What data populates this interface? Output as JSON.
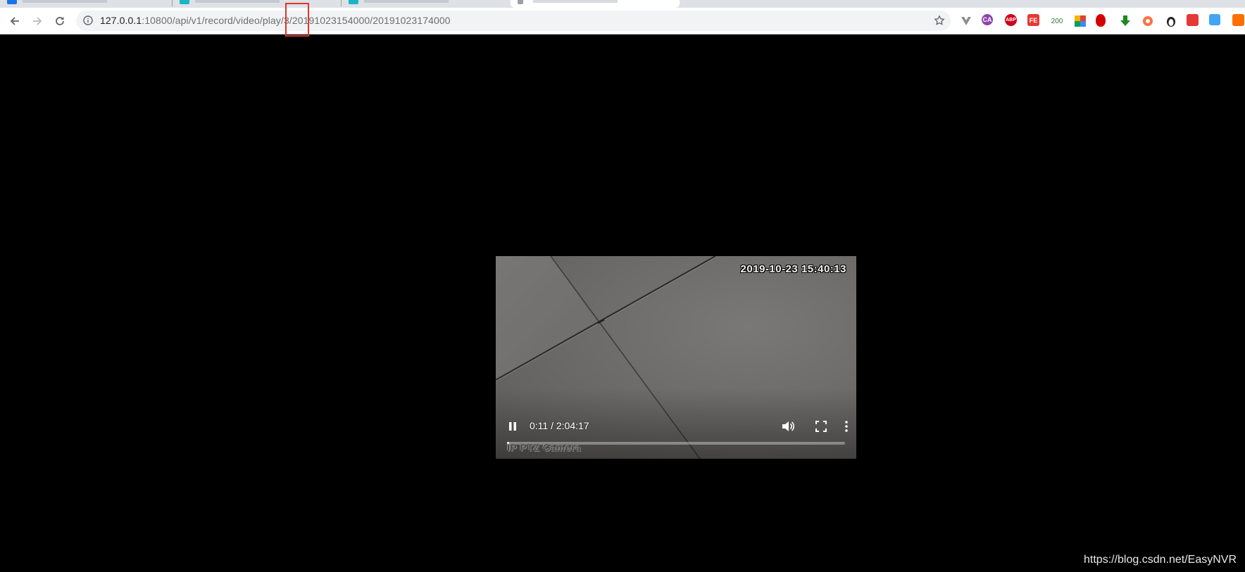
{
  "browser": {
    "tabs": [
      {
        "name": "tab-1",
        "favicon_color": "#1a73e8",
        "active": false
      },
      {
        "name": "tab-2",
        "favicon_color": "#19b5c8",
        "active": false
      },
      {
        "name": "tab-3",
        "favicon_color": "#19b5c8",
        "active": false
      },
      {
        "name": "tab-4",
        "favicon_color": "#9aa0a6",
        "active": true
      }
    ],
    "address": {
      "host": "127.0.0.1",
      "rest": ":10800/api/v1/record/video/play/3/20191023154000/20191023174000"
    },
    "extensions": [
      {
        "name": "vue-devtools-icon",
        "label": "",
        "color": "#8c8c8c"
      },
      {
        "name": "ca-extension-icon",
        "label": "CA",
        "color": "#8e44ad"
      },
      {
        "name": "adblock-plus-icon",
        "label": "ABP",
        "color": "#d0021b"
      },
      {
        "name": "fe-helper-icon",
        "label": "FE",
        "color": "#e53935"
      },
      {
        "name": "status-200-icon",
        "label": "200",
        "color": "#2e7d32"
      },
      {
        "name": "color-picker-icon",
        "label": "",
        "color": "#4caf50"
      },
      {
        "name": "stop-hand-icon",
        "label": "",
        "color": "#d50000"
      },
      {
        "name": "download-arrow-icon",
        "label": "",
        "color": "#1b8a1b"
      },
      {
        "name": "lifebuoy-icon",
        "label": "",
        "color": "#ff7043"
      },
      {
        "name": "penguin-icon",
        "label": "",
        "color": "#222222"
      },
      {
        "name": "face-extension-icon",
        "label": "",
        "color": "#e53935"
      },
      {
        "name": "image-extension-icon",
        "label": "",
        "color": "#42a5f5"
      },
      {
        "name": "orange-extension-icon",
        "label": "",
        "color": "#ff6f00"
      }
    ]
  },
  "player": {
    "osd_timestamp": "2019-10-23 15:40:13",
    "osd_camera": "IP PTZ Camera",
    "current_time": "0:11",
    "duration": "2:04:17",
    "timecode": "0:11 / 2:04:17",
    "progress_fraction": 0.0015,
    "state": "playing"
  },
  "watermark": "https://blog.csdn.net/EasyNVR",
  "colors": {
    "page_background": "#000000",
    "highlight_box": "#e0352b"
  }
}
